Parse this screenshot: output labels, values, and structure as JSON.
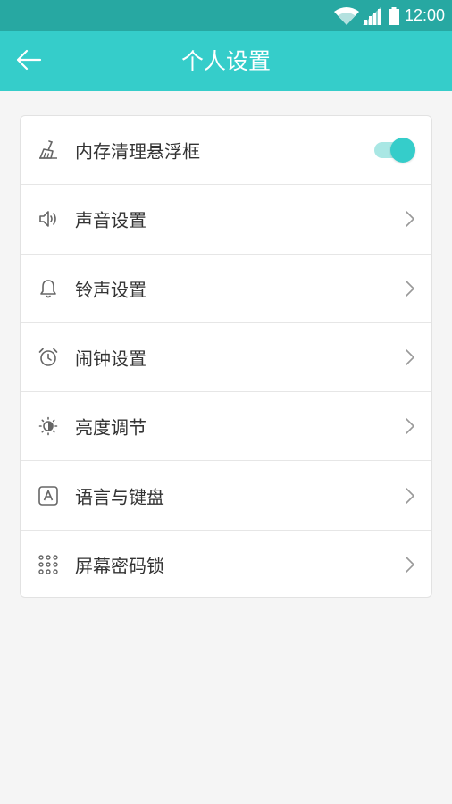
{
  "status_bar": {
    "time": "12:00",
    "icons": [
      "wifi-icon",
      "signal-icon",
      "battery-icon"
    ]
  },
  "app_bar": {
    "title": "个人设置",
    "back_icon": "arrow-left-icon"
  },
  "colors": {
    "status_bar_bg": "#27a8a2",
    "app_bar_bg": "#35cdca",
    "accent": "#35cdca",
    "page_bg": "#f5f5f5"
  },
  "settings": {
    "items": [
      {
        "label": "内存清理悬浮框",
        "icon": "broom-icon",
        "control": "toggle",
        "toggle_on": true
      },
      {
        "label": "声音设置",
        "icon": "speaker-icon",
        "control": "chevron"
      },
      {
        "label": "铃声设置",
        "icon": "bell-icon",
        "control": "chevron"
      },
      {
        "label": "闹钟设置",
        "icon": "alarm-clock-icon",
        "control": "chevron"
      },
      {
        "label": "亮度调节",
        "icon": "brightness-icon",
        "control": "chevron"
      },
      {
        "label": "语言与键盘",
        "icon": "keyboard-letter-icon",
        "control": "chevron"
      },
      {
        "label": "屏幕密码锁",
        "icon": "pattern-lock-icon",
        "control": "chevron"
      }
    ]
  }
}
